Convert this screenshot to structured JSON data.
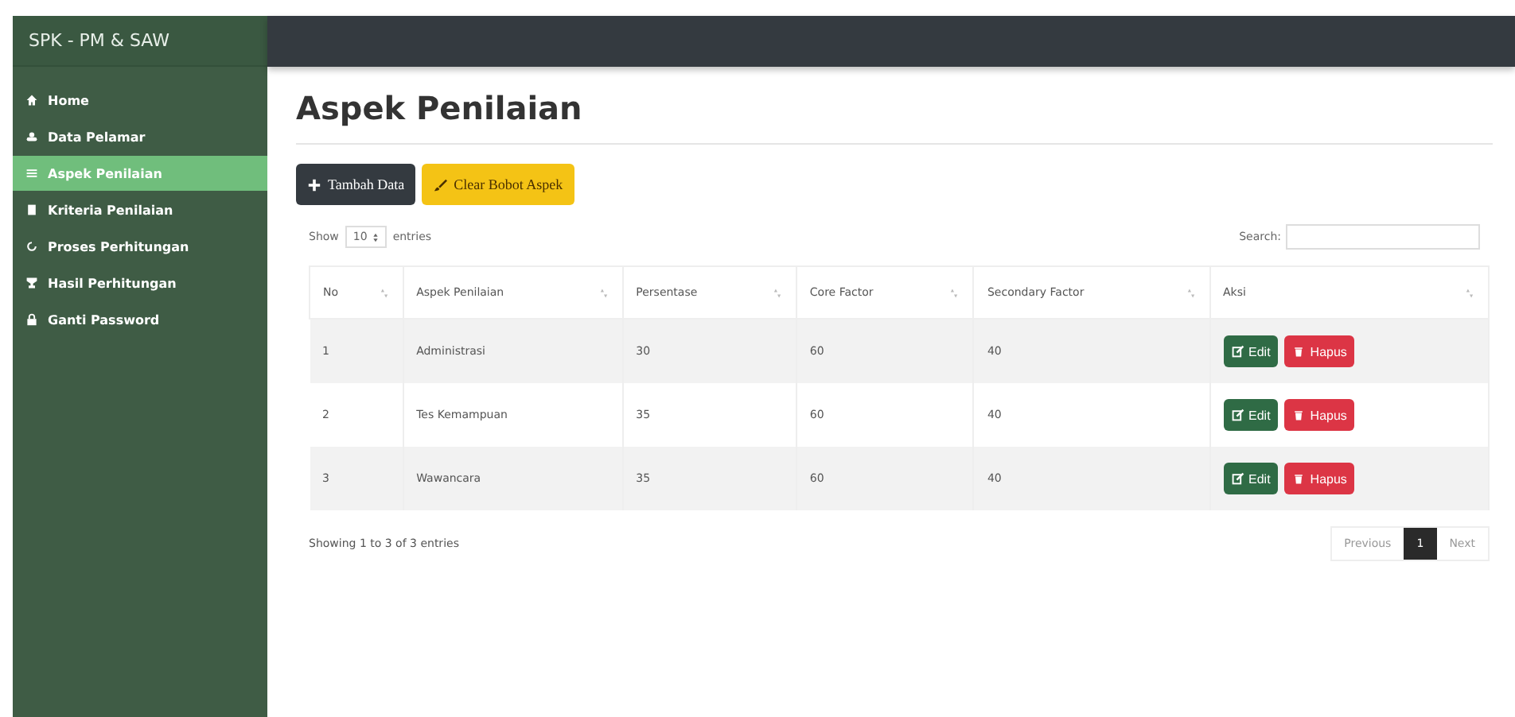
{
  "brand": "SPK - PM & SAW",
  "sidebar": {
    "items": [
      {
        "label": "Home",
        "kind": "home",
        "selected": false
      },
      {
        "label": "Data Pelamar",
        "kind": "users",
        "selected": false
      },
      {
        "label": "Aspek Penilaian",
        "kind": "list",
        "selected": true
      },
      {
        "label": "Kriteria Penilaian",
        "kind": "book",
        "selected": false
      },
      {
        "label": "Proses Perhitungan",
        "kind": "refresh",
        "selected": false
      },
      {
        "label": "Hasil Perhitungan",
        "kind": "trophy",
        "selected": false
      },
      {
        "label": "Ganti Password",
        "kind": "lock",
        "selected": false
      }
    ]
  },
  "page_title": "Aspek Penilaian",
  "toolbar": [
    {
      "label": "Tambah Data",
      "kind": "add"
    },
    {
      "label": "Clear Bobot Aspek",
      "kind": "clear"
    }
  ],
  "length_control": {
    "before": "Show",
    "value": "10",
    "after": "entries"
  },
  "search": {
    "label": "Search:"
  },
  "table": {
    "columns": [
      "No",
      "Aspek Penilaian",
      "Persentase",
      "Core Factor",
      "Secondary Factor",
      "Aksi"
    ],
    "rows": [
      {
        "cells": [
          "1",
          "Administrasi",
          "30",
          "60",
          "40"
        ],
        "actions": [
          "Edit",
          "Hapus"
        ]
      },
      {
        "cells": [
          "2",
          "Tes Kemampuan",
          "35",
          "60",
          "40"
        ],
        "actions": [
          "Edit",
          "Hapus"
        ]
      },
      {
        "cells": [
          "3",
          "Wawancara",
          "35",
          "60",
          "40"
        ],
        "actions": [
          "Edit",
          "Hapus"
        ]
      }
    ]
  },
  "info": "Showing 1 to 3 of 3 entries",
  "pagination": [
    {
      "label": "Previous",
      "selected": false
    },
    {
      "label": "1",
      "selected": true
    },
    {
      "label": "Next",
      "selected": false
    }
  ]
}
